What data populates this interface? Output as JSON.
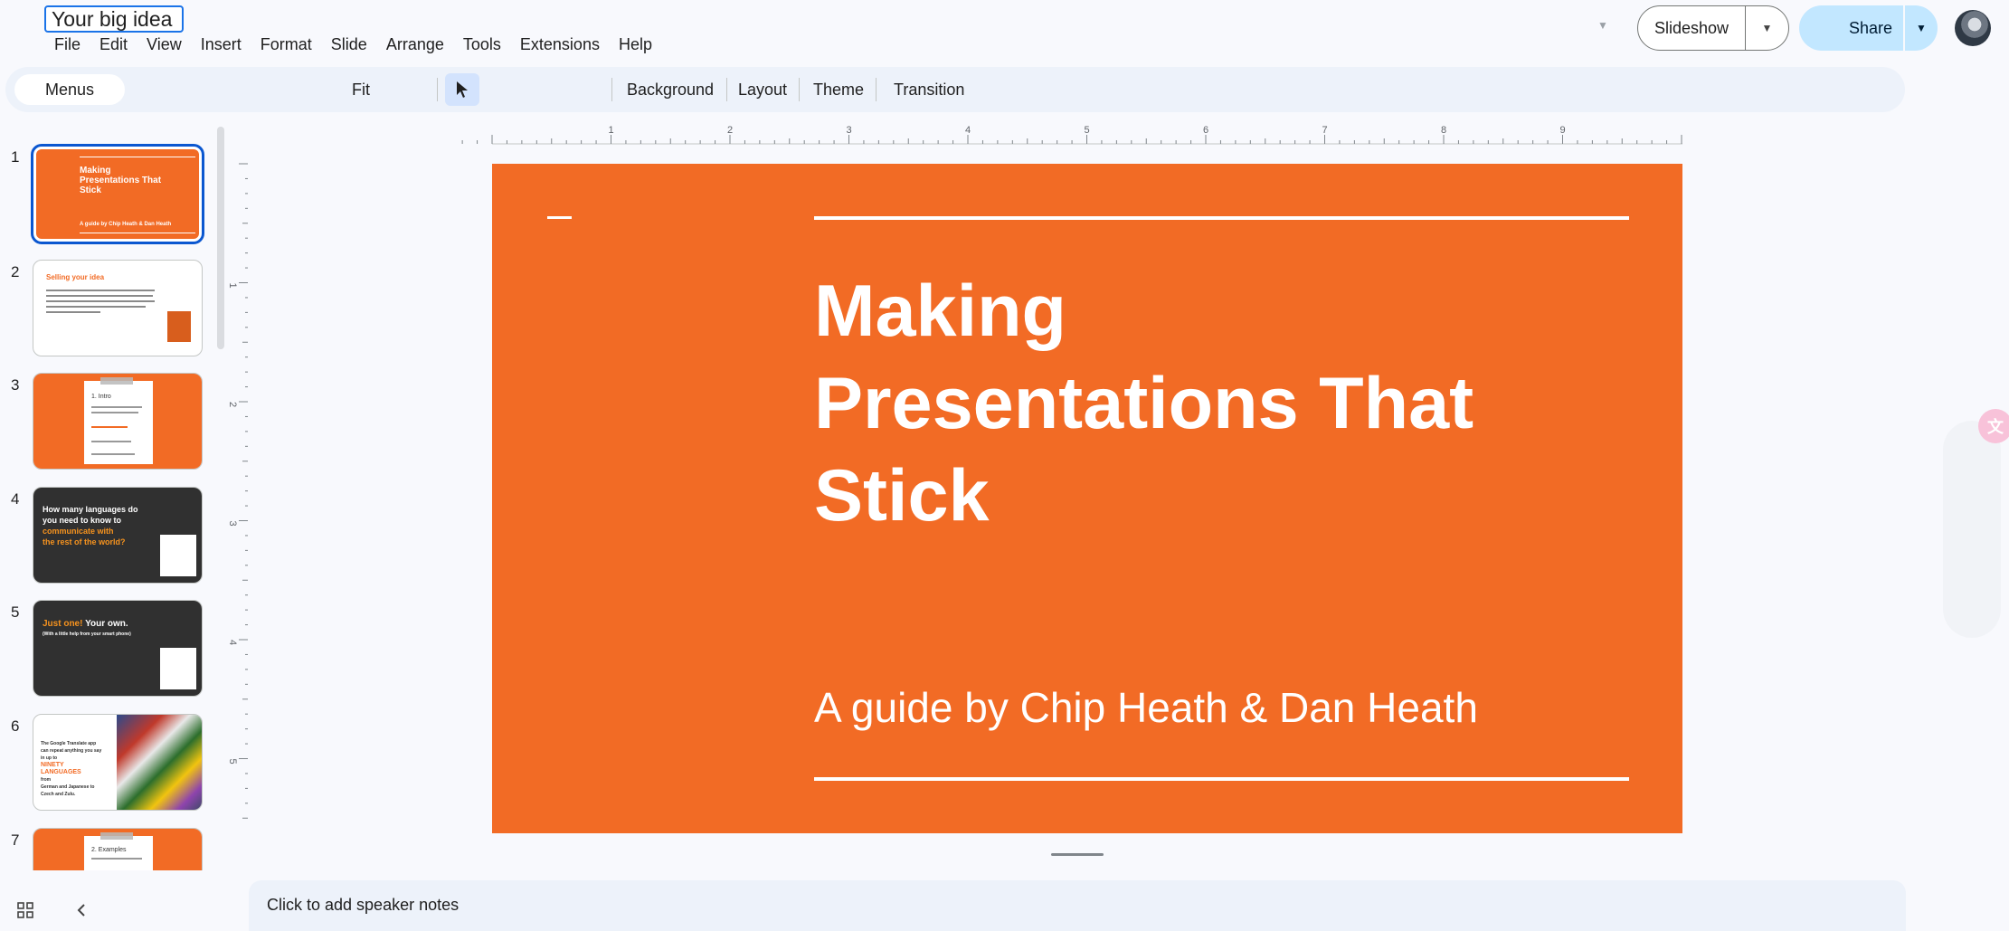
{
  "document": {
    "title": "Your big idea"
  },
  "menu": [
    "File",
    "Edit",
    "View",
    "Insert",
    "Format",
    "Slide",
    "Arrange",
    "Tools",
    "Extensions",
    "Help"
  ],
  "header": {
    "slideshow_label": "Slideshow",
    "share_label": "Share"
  },
  "toolbar": {
    "menus_label": "Menus",
    "zoom_label": "Fit",
    "background_label": "Background",
    "layout_label": "Layout",
    "theme_label": "Theme",
    "transition_label": "Transition"
  },
  "filmstrip": {
    "slides": [
      {
        "number": "1",
        "text_lines": [
          "Making",
          "Presentations That",
          "Stick"
        ],
        "subtitle": "A guide by Chip Heath & Dan Heath"
      },
      {
        "number": "2",
        "title": "Selling your idea"
      },
      {
        "number": "3",
        "title": "1. Intro"
      },
      {
        "number": "4",
        "text_lines": [
          "How many languages do",
          "you need to know to"
        ],
        "accent_lines": [
          "communicate with",
          "the rest of the world?"
        ]
      },
      {
        "number": "5",
        "accent": "Just one!",
        "text": "Your own.",
        "small": "(With a little help from your smart phone)"
      },
      {
        "number": "6",
        "text_lines": [
          "The Google Translate app",
          "can repeat anything you say",
          "in up to"
        ],
        "accent_lines": [
          "NINETY",
          "LANGUAGES"
        ],
        "tail_lines": [
          "from",
          "German and Japanese to",
          "Czech and Zulu."
        ]
      },
      {
        "number": "7",
        "title": "2. Examples"
      }
    ]
  },
  "slide": {
    "title": "Making Presentations That Stick",
    "title_lines": [
      "Making",
      "Presentations That",
      "Stick"
    ],
    "subtitle": "A guide by Chip Heath & Dan Heath"
  },
  "ruler": {
    "top_labels": [
      "1",
      "2",
      "3",
      "4",
      "5",
      "6",
      "7",
      "8",
      "9"
    ],
    "left_labels": [
      "1",
      "2",
      "3",
      "4",
      "5"
    ]
  },
  "notes": {
    "placeholder": "Click to add speaker notes"
  },
  "colors": {
    "slide_orange": "#f26b25",
    "selection_blue": "#0b57d0",
    "share_blue": "#c2e7ff"
  }
}
